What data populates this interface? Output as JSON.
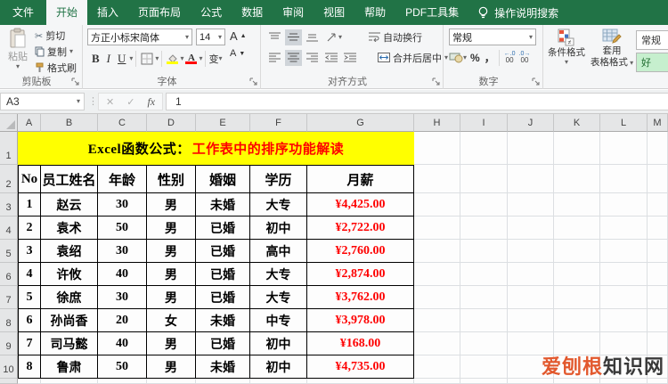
{
  "tab_bar": {
    "file_tab": "文件",
    "tabs": [
      "开始",
      "插入",
      "页面布局",
      "公式",
      "数据",
      "审阅",
      "视图",
      "帮助",
      "PDF工具集"
    ],
    "active_tab": "开始",
    "tell_me": "操作说明搜索"
  },
  "ribbon": {
    "clipboard": {
      "label": "剪贴板",
      "paste": "粘贴",
      "cut": "剪切",
      "copy": "复制",
      "format_painter": "格式刷"
    },
    "font": {
      "label": "字体",
      "font_name": "方正小标宋简体",
      "font_size": "14",
      "bold": "B",
      "italic": "I",
      "underline": "U",
      "phonetic": "变"
    },
    "alignment": {
      "label": "对齐方式",
      "wrap_text": "自动换行",
      "merge_center": "合并后居中"
    },
    "number": {
      "label": "数字",
      "format": "常规",
      "percent": "%",
      "comma": "，",
      "decimal_zeros": "00"
    },
    "styles": {
      "conditional": "条件格式",
      "format_as_table_line1": "套用",
      "format_as_table_line2": "表格格式",
      "cell_styles": [
        "常规",
        "好"
      ]
    }
  },
  "formula_bar": {
    "name_box": "A3",
    "cancel": "✕",
    "enter": "✓",
    "fx": "fx",
    "content": "1"
  },
  "sheet": {
    "column_headers": [
      "A",
      "B",
      "C",
      "D",
      "E",
      "F",
      "G",
      "H",
      "I",
      "J",
      "K",
      "L",
      "M"
    ],
    "row_headers": [
      "1",
      "2",
      "3",
      "4",
      "5",
      "6",
      "7",
      "8",
      "9",
      "10"
    ],
    "title": {
      "black": "Excel函数公式：",
      "red": "工作表中的排序功能解读"
    },
    "table_headers": [
      "No",
      "员工姓名",
      "年龄",
      "性别",
      "婚姻",
      "学历",
      "月薪"
    ],
    "rows": [
      [
        "1",
        "赵云",
        "30",
        "男",
        "未婚",
        "大专",
        "¥4,425.00"
      ],
      [
        "2",
        "袁术",
        "50",
        "男",
        "已婚",
        "初中",
        "¥2,722.00"
      ],
      [
        "3",
        "袁绍",
        "30",
        "男",
        "已婚",
        "高中",
        "¥2,760.00"
      ],
      [
        "4",
        "许攸",
        "40",
        "男",
        "已婚",
        "大专",
        "¥2,874.00"
      ],
      [
        "5",
        "徐庶",
        "30",
        "男",
        "已婚",
        "大专",
        "¥3,762.00"
      ],
      [
        "6",
        "孙尚香",
        "20",
        "女",
        "未婚",
        "中专",
        "¥3,978.00"
      ],
      [
        "7",
        "司马懿",
        "40",
        "男",
        "已婚",
        "初中",
        "¥168.00"
      ],
      [
        "8",
        "鲁肃",
        "50",
        "男",
        "未婚",
        "初中",
        "¥4,735.00"
      ]
    ]
  },
  "watermark": {
    "highlight": "爱刨根",
    "rest": "知识网"
  },
  "colors": {
    "excel_green": "#217346",
    "title_background": "#ffff00",
    "title_red_text": "#fe0000",
    "salary_red": "#fe0000",
    "good_style_background": "#c6efce",
    "good_style_text": "#1e6b2e",
    "fill_color_swatch": "#ffff00",
    "font_color_swatch": "#ff0000",
    "watermark_orange": "#e2582d"
  }
}
